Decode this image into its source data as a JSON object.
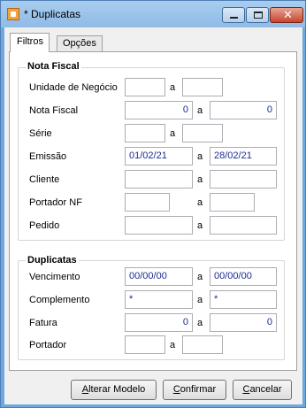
{
  "window": {
    "title": "* Duplicatas"
  },
  "tabs": [
    {
      "label": "Filtros"
    },
    {
      "label": "Opções"
    }
  ],
  "nota_fiscal": {
    "title": "Nota Fiscal",
    "separator": "a",
    "rows": [
      {
        "label": "Unidade de Negócio",
        "from": "",
        "to": ""
      },
      {
        "label": "Nota Fiscal",
        "from": "0",
        "to": "0"
      },
      {
        "label": "Série",
        "from": "",
        "to": ""
      },
      {
        "label": "Emissão",
        "from": "01/02/21",
        "to": "28/02/21"
      },
      {
        "label": "Cliente",
        "from": "",
        "to": ""
      },
      {
        "label": "Portador NF",
        "from": "",
        "to": ""
      },
      {
        "label": "Pedido",
        "from": "",
        "to": ""
      }
    ]
  },
  "duplicatas": {
    "title": "Duplicatas",
    "separator": "a",
    "rows": [
      {
        "label": "Vencimento",
        "from": "00/00/00",
        "to": "00/00/00"
      },
      {
        "label": "Complemento",
        "from": "*",
        "to": "*"
      },
      {
        "label": "Fatura",
        "from": "0",
        "to": "0"
      },
      {
        "label": "Portador",
        "from": "",
        "to": ""
      }
    ]
  },
  "buttons": {
    "alterar_modelo": "Alterar Modelo",
    "confirmar": "Confirmar",
    "cancelar": "Cancelar"
  }
}
